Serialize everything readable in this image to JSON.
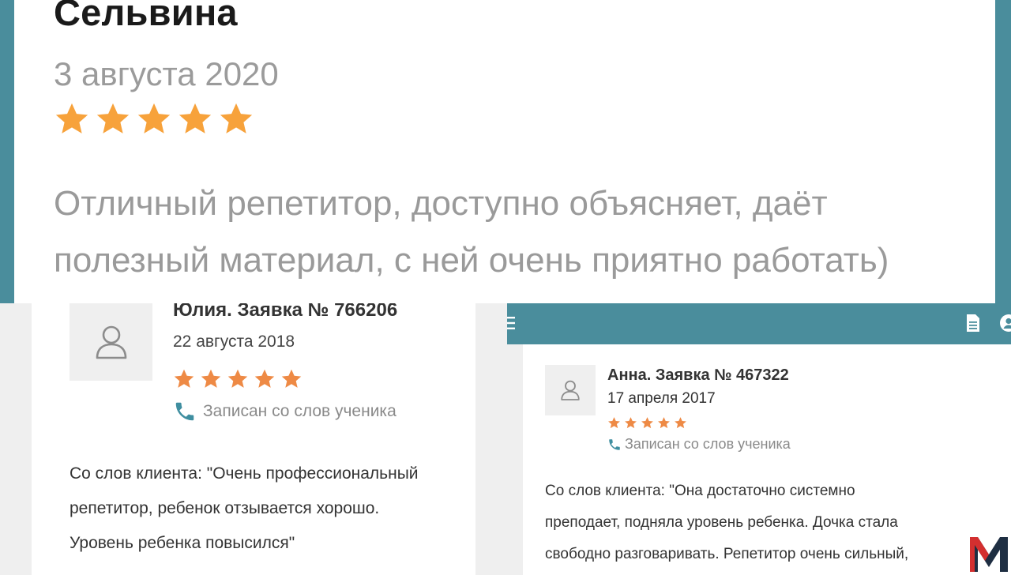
{
  "top_review": {
    "name": "Сельвина",
    "date": "3 августа 2020",
    "rating": 5,
    "text": "Отличный репетитор, доступно объясняет, даёт полезный материал, с ней очень приятно работать)"
  },
  "review_left": {
    "title": "Юлия. Заявка № 766206",
    "date": "22 августа 2018",
    "rating": 5,
    "source": "Записан со слов ученика",
    "text": "Со слов клиента: \"Очень профессиональный репетитор, ребенок отзывается хорошо. Уровень ребенка повысился\""
  },
  "review_right": {
    "title": "Анна. Заявка № 467322",
    "date": "17 апреля 2017",
    "rating": 5,
    "source": "Записан со слов ученика",
    "text_lines": [
      "Со слов клиента: \"Она достаточно системно",
      "преподает, подняла уровень ребенка. Дочка стала",
      "свободно разговаривать. Репетитор очень сильный,"
    ]
  },
  "icons": {
    "star": "star-icon",
    "avatar": "user-icon",
    "phone": "phone-icon",
    "menu": "menu-icon",
    "document": "document-icon",
    "account": "account-icon",
    "logo": "m-logo"
  },
  "colors": {
    "accent": "#4a8d9c",
    "star": "#f7a23b",
    "star_small": "#ee8a45",
    "phone": "#3f8ea0"
  }
}
